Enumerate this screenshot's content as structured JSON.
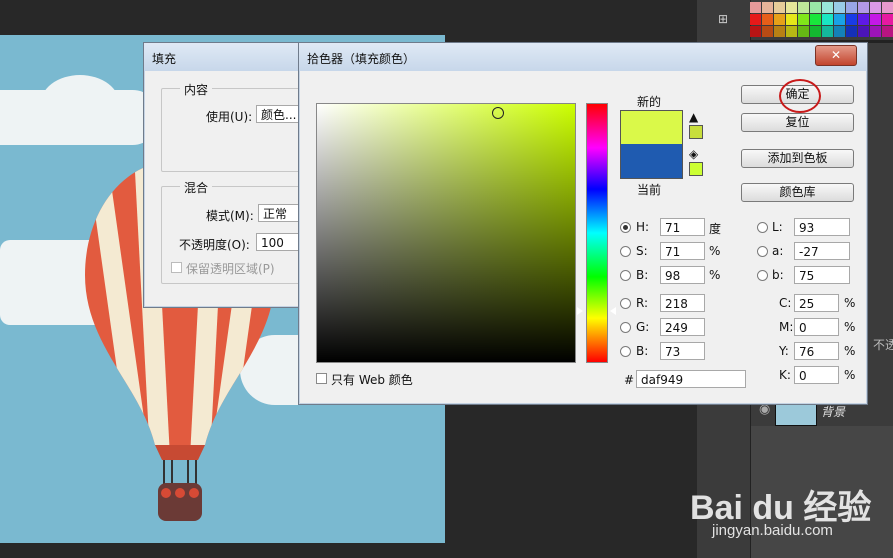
{
  "fill_dialog": {
    "title": "填充",
    "content_group": "内容",
    "use_label": "使用(U):",
    "use_value": "颜色...",
    "blend_group": "混合",
    "mode_label": "模式(M):",
    "mode_value": "正常",
    "opacity_label": "不透明度(O):",
    "opacity_value": "100",
    "preserve_label": "保留透明区域(P)"
  },
  "picker": {
    "title": "拾色器（填充颜色）",
    "close_glyph": "✕",
    "new_label": "新的",
    "current_label": "当前",
    "new_color": "#daf949",
    "current_color": "#1f5bb0",
    "ok_label": "确定",
    "reset_label": "复位",
    "add_swatch_label": "添加到色板",
    "library_label": "颜色库",
    "web_only_label": "只有 Web 颜色",
    "hex_prefix": "#",
    "hex_value": "daf949",
    "hsb": [
      {
        "label": "H:",
        "value": "71",
        "unit": "度",
        "selected": true
      },
      {
        "label": "S:",
        "value": "71",
        "unit": "%",
        "selected": false
      },
      {
        "label": "B:",
        "value": "98",
        "unit": "%",
        "selected": false
      }
    ],
    "rgb": [
      {
        "label": "R:",
        "value": "218"
      },
      {
        "label": "G:",
        "value": "249"
      },
      {
        "label": "B:",
        "value": "73"
      }
    ],
    "lab": [
      {
        "label": "L:",
        "value": "93"
      },
      {
        "label": "a:",
        "value": "-27"
      },
      {
        "label": "b:",
        "value": "75"
      }
    ],
    "cmyk": [
      {
        "label": "C:",
        "value": "25",
        "unit": "%"
      },
      {
        "label": "M:",
        "value": "0",
        "unit": "%"
      },
      {
        "label": "Y:",
        "value": "76",
        "unit": "%"
      },
      {
        "label": "K:",
        "value": "0",
        "unit": "%"
      }
    ]
  },
  "layers": {
    "partial_label": "不透",
    "background_layer": "背景"
  },
  "watermark": {
    "brand": "Bai du 经验",
    "url": "jingyan.baidu.com"
  },
  "colors": {
    "canvas_sky": "#7ab9d0",
    "balloon_red": "#e25b3f",
    "balloon_cream": "#f4ead2",
    "basket": "#6b3a36",
    "ok_highlight_circle": "#c81a1a"
  }
}
